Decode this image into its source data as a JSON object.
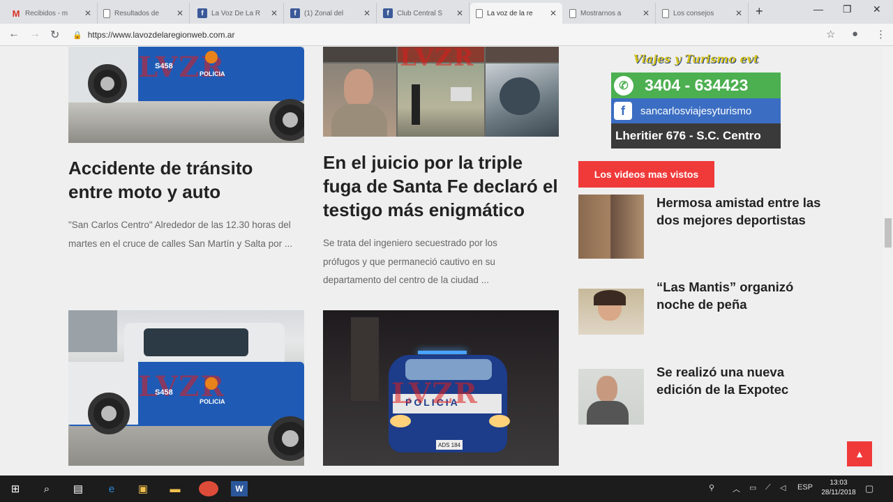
{
  "browser": {
    "tabs": [
      {
        "icon": "gmail-icon",
        "title": "Recibidos - m"
      },
      {
        "icon": "page-icon",
        "title": "Resultados de"
      },
      {
        "icon": "facebook-icon",
        "title": "La Voz De La R"
      },
      {
        "icon": "facebook-icon",
        "title": "(1) Zonal del"
      },
      {
        "icon": "facebook-icon",
        "title": "Club Central S"
      },
      {
        "icon": "page-icon",
        "title": "La voz de la re"
      },
      {
        "icon": "page-icon",
        "title": "Mostrarnos a"
      },
      {
        "icon": "page-icon",
        "title": "Los consejos"
      }
    ],
    "active_tab": 5,
    "url": "https://www.lavozdelaregionweb.com.ar"
  },
  "articles": [
    {
      "title": "Accidente de tránsito entre moto y auto",
      "excerpt": "\"San Carlos Centro\" Alrededor de las 12.30 horas del martes en el cruce de calles San Martín y Salta por ..."
    },
    {
      "title": "En el juicio por la triple fuga de Santa Fe declaró el testigo más enigmático",
      "excerpt": "Se trata del ingeniero secuestrado por los prófugos y que permaneció cautivo en su departamento del centro de la ciudad ..."
    }
  ],
  "photos": {
    "watermark": "LVZR",
    "truck_plate": "S458",
    "truck_label": "POLICIA",
    "car_label": "POLICIA",
    "car_plate": "ADS 184"
  },
  "ad": {
    "title": "Viajes y Turismo evt",
    "phone": "3404 - 634423",
    "facebook": "sancarlosviajesyturismo",
    "address": "Lheritier 676 - S.C. Centro"
  },
  "sidebar": {
    "section_title": "Los videos mas vistos",
    "videos": [
      {
        "title": "Hermosa amistad entre las dos mejores deportistas"
      },
      {
        "title": "“Las Mantis” organizó noche de peña"
      },
      {
        "title": "Se realizó una nueva edición de la Expotec"
      }
    ]
  },
  "taskbar": {
    "language": "ESP",
    "time": "13:03",
    "date": "28/11/2018"
  }
}
